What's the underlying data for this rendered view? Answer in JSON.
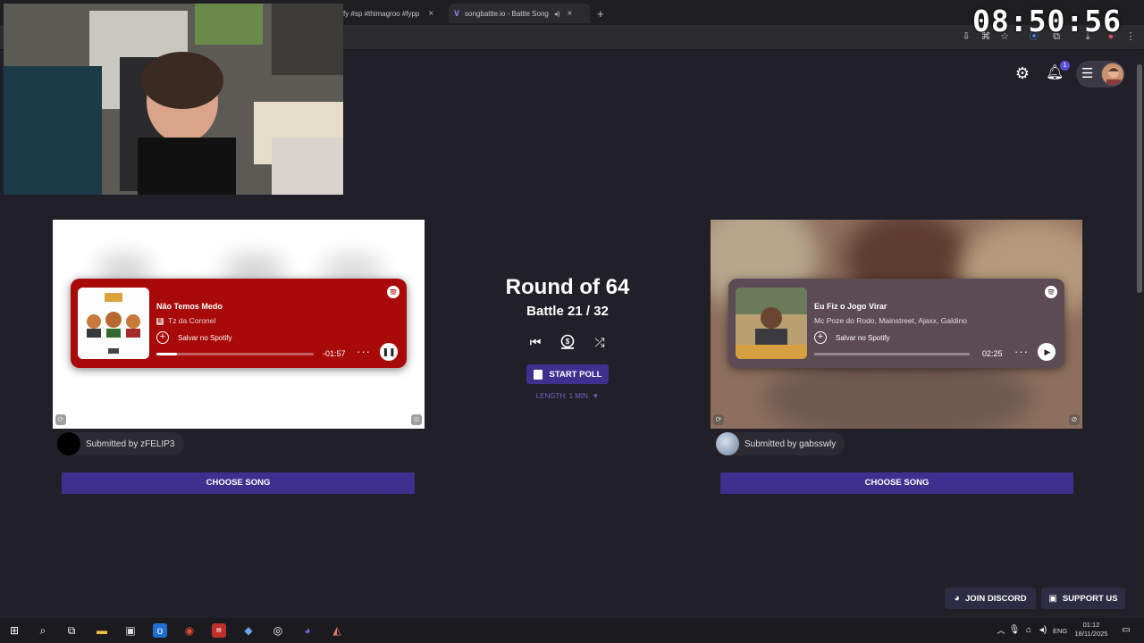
{
  "browser": {
    "tabs": [
      {
        "label": "fy #sp #thimagroo #fypp",
        "active": false
      },
      {
        "label": "songbattle.io - Battle Song",
        "active": true
      }
    ],
    "new_tab": "+",
    "close_glyph": "×"
  },
  "overlay": {
    "clock": "08:50:56"
  },
  "header": {
    "notification_count": "1"
  },
  "round": {
    "title": "Round of 64",
    "battle": "Battle 21 / 32"
  },
  "controls": {
    "start_poll": "START POLL",
    "length": "LENGTH: 1 MIN. ▼"
  },
  "left_song": {
    "title": "Não Temos Medo",
    "artist": "Tz da Coronel",
    "explicit": "E",
    "save": "Salvar no Spotify",
    "time": "-01:57",
    "progress": 0.13,
    "playing": true,
    "submitted_by": "Submitted by zFELIP3",
    "choose": "CHOOSE SONG",
    "accent": "#a80a0a"
  },
  "right_song": {
    "title": "Eu Fiz o Jogo Virar",
    "artist": "Mc Poze do Rodo, Mainstreet, Ajaxx, Galdino",
    "save": "Salvar no Spotify",
    "time": "02:25",
    "progress": 0.0,
    "playing": false,
    "submitted_by": "Submitted by gabsswly",
    "choose": "CHOOSE SONG",
    "accent": "#5c4a55"
  },
  "footer": {
    "discord": "JOIN DISCORD",
    "support": "SUPPORT US"
  },
  "taskbar": {
    "lang": "ENG",
    "time": "01:12",
    "date": "18/11/2025"
  },
  "colors": {
    "primary_button": "#3f2f8f",
    "page_bg": "#212028",
    "length_text": "#6e63c4"
  }
}
